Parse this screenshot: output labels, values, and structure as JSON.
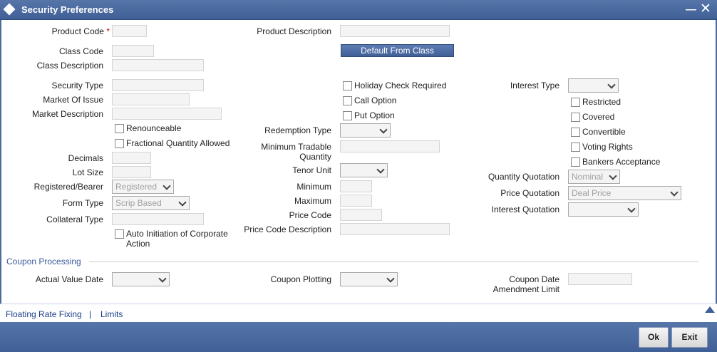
{
  "window": {
    "title": "Security Preferences"
  },
  "labels": {
    "product_code": "Product Code",
    "product_description": "Product Description",
    "class_code": "Class Code",
    "class_description": "Class Description",
    "security_type": "Security Type",
    "market_of_issue": "Market Of Issue",
    "market_description": "Market Description",
    "decimals": "Decimals",
    "lot_size": "Lot Size",
    "registered_bearer": "Registered/Bearer",
    "form_type": "Form Type",
    "collateral_type": "Collateral Type",
    "redemption_type": "Redemption Type",
    "minimum_tradable_quantity_1": "Minimum Tradable",
    "minimum_tradable_quantity_2": "Quantity",
    "tenor_unit": "Tenor Unit",
    "minimum": "Minimum",
    "maximum": "Maximum",
    "price_code": "Price Code",
    "price_code_description": "Price Code Description",
    "interest_type": "Interest Type",
    "quantity_quotation": "Quantity Quotation",
    "price_quotation": "Price Quotation",
    "interest_quotation": "Interest Quotation",
    "actual_value_date": "Actual Value Date",
    "coupon_plotting": "Coupon Plotting",
    "coupon_date_amendment_limit_1": "Coupon Date",
    "coupon_date_amendment_limit_2": "Amendment Limit"
  },
  "required_marker": "*",
  "buttons": {
    "default_from_class": "Default From Class",
    "ok": "Ok",
    "exit": "Exit"
  },
  "checkboxes": {
    "renounceable": "Renounceable",
    "fractional_quantity_allowed": "Fractional Quantity Allowed",
    "auto_initiation_1": "Auto Initiation of Corporate",
    "auto_initiation_2": "Action",
    "holiday_check_required": "Holiday Check Required",
    "call_option": "Call Option",
    "put_option": "Put Option",
    "restricted": "Restricted",
    "covered": "Covered",
    "convertible": "Convertible",
    "voting_rights": "Voting Rights",
    "bankers_acceptance": "Bankers Acceptance"
  },
  "selects": {
    "registered_bearer": "Registered",
    "form_type": "Scrip Based",
    "quantity_quotation": "Nominal",
    "price_quotation": "Deal Price"
  },
  "sections": {
    "coupon_processing": "Coupon Processing"
  },
  "links": {
    "floating_rate_fixing": "Floating Rate Fixing",
    "separator": "|",
    "limits": "Limits"
  },
  "colors": {
    "title_bar": "#4a6aa0",
    "link": "#1a3e8a",
    "required": "#cc0000",
    "section_title": "#3b5a9a"
  },
  "icons": {
    "window": "diamond-icon",
    "minimize": "minimize-icon",
    "close": "close-icon",
    "scroll": "scroll-up-icon"
  }
}
